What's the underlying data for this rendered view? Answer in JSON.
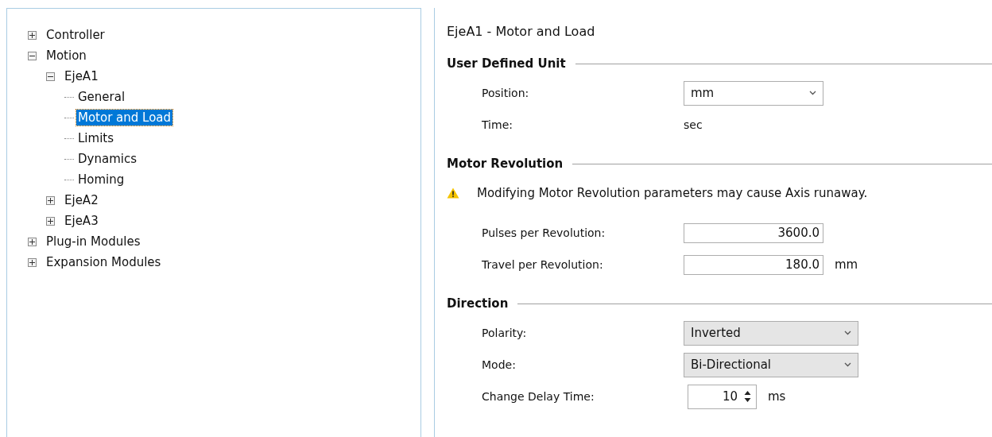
{
  "tree": [
    {
      "label": "Controller",
      "expanded": false,
      "selected": false
    },
    {
      "label": "Motion",
      "expanded": true,
      "selected": false,
      "children": [
        {
          "label": "EjeA1",
          "expanded": true,
          "selected": false,
          "children": [
            {
              "label": "General",
              "selected": false
            },
            {
              "label": "Motor and Load",
              "selected": true
            },
            {
              "label": "Limits",
              "selected": false
            },
            {
              "label": "Dynamics",
              "selected": false
            },
            {
              "label": "Homing",
              "selected": false
            }
          ]
        },
        {
          "label": "EjeA2",
          "expanded": false,
          "selected": false
        },
        {
          "label": "EjeA3",
          "expanded": false,
          "selected": false
        }
      ]
    },
    {
      "label": "Plug-in Modules",
      "expanded": false,
      "selected": false
    },
    {
      "label": "Expansion Modules",
      "expanded": false,
      "selected": false
    }
  ],
  "panel": {
    "title": "EjeA1 - Motor and Load",
    "sections": [
      {
        "title": "User Defined Unit",
        "rows": [
          {
            "kind": "combo",
            "label": "Position:",
            "value": "mm"
          },
          {
            "kind": "text",
            "label": "Time:",
            "value": "sec"
          }
        ]
      },
      {
        "title": "Motor Revolution",
        "warning": "Modifying Motor Revolution parameters may cause Axis runaway.",
        "rows": [
          {
            "kind": "number",
            "label": "Pulses per Revolution:",
            "value": "3600.0"
          },
          {
            "kind": "number",
            "label": "Travel per Revolution:",
            "value": "180.0",
            "unit": "mm"
          }
        ]
      },
      {
        "title": "Direction",
        "rows": [
          {
            "kind": "select",
            "label": "Polarity:",
            "value": "Inverted"
          },
          {
            "kind": "select",
            "label": "Mode:",
            "value": "Bi-Directional"
          },
          {
            "kind": "spinner",
            "label": "Change Delay Time:",
            "value": "10",
            "unit": "ms"
          }
        ]
      }
    ]
  }
}
